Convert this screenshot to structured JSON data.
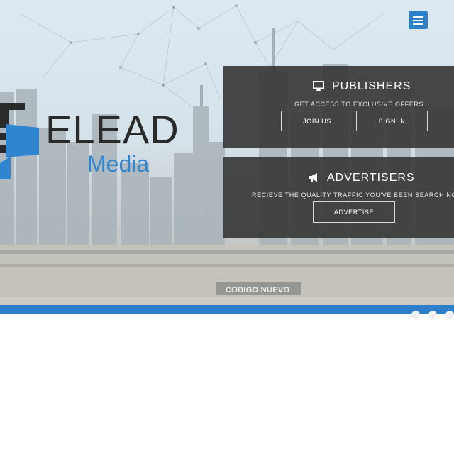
{
  "header": {
    "menu_icon": "hamburger-menu-icon"
  },
  "logo": {
    "line1": "ELEAD",
    "line2": "Media"
  },
  "publishers": {
    "title": "PUBLISHERS",
    "icon": "monitor-icon",
    "subtitle": "GET ACCESS TO EXCLUSIVE OFFERS",
    "join_label": "JOIN US",
    "signin_label": "SIGN IN"
  },
  "advertisers": {
    "title": "ADVERTISERS",
    "icon": "megaphone-icon",
    "subtitle": "RECIEVE THE QUALITY TRAFFIC YOU'VE BEEN SEARCHING FOR",
    "advertise_label": "ADVERTISE"
  },
  "background": {
    "sign_text": "CODIGO NUEVO"
  },
  "colors": {
    "accent": "#2e7fc9",
    "panel": "#3a3a3a",
    "logo_dark": "#2a2a2a",
    "logo_blue": "#2f86cf"
  }
}
